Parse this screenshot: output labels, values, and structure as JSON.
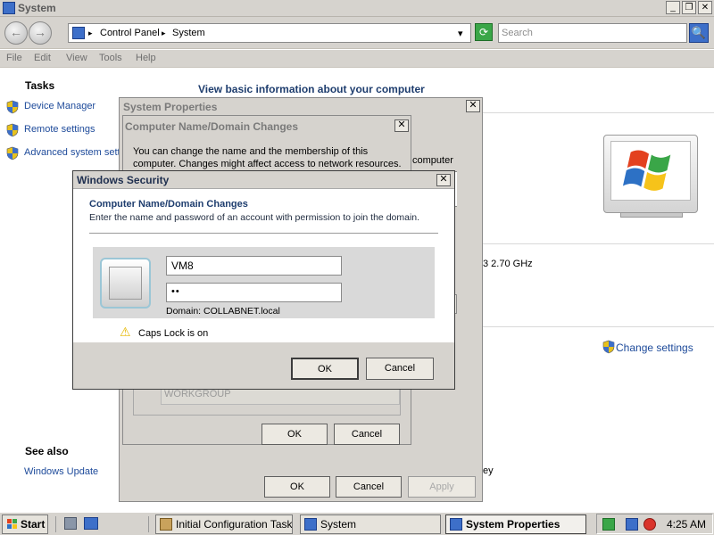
{
  "window": {
    "title": "System",
    "caption_buttons": {
      "min": "_",
      "max": "❐",
      "close": "✕"
    }
  },
  "nav": {
    "back": "←",
    "forward": "→",
    "breadcrumb": [
      "Control Panel",
      "System"
    ],
    "arrow": "▸",
    "dropdown": "▾",
    "refresh": "⟳",
    "search_placeholder": "Search",
    "search_icon": "🔍"
  },
  "menu": [
    "File",
    "Edit",
    "View",
    "Tools",
    "Help"
  ],
  "tasks": {
    "heading": "Tasks",
    "items": [
      "Device Manager",
      "Remote settings",
      "Advanced system settings"
    ]
  },
  "main": {
    "heading": "View basic information about your computer",
    "computer_fragment": "computer",
    "processor_fragment": "3   2.70 GHz",
    "change_settings": "Change settings",
    "ey_fragment": "ey"
  },
  "see_also": {
    "heading": "See also",
    "items": [
      "Windows Update"
    ]
  },
  "system_properties": {
    "title": "System Properties",
    "ok": "OK",
    "cancel": "Cancel",
    "apply": "Apply"
  },
  "cndc": {
    "title": "Computer Name/Domain Changes",
    "description": "You can change the name and the membership of this computer. Changes might affect access to network resources.",
    "workgroup_value": "WORKGROUP",
    "ok": "OK",
    "cancel": "Cancel"
  },
  "windows_security": {
    "title": "Windows Security",
    "heading": "Computer Name/Domain Changes",
    "subtitle": "Enter the name and password of an account with permission to join the domain.",
    "username": "VM8",
    "password": "••",
    "domain_label": "Domain: COLLABNET.local",
    "caps_warning": "Caps Lock is on",
    "warning_icon": "⚠",
    "ok": "OK",
    "cancel": "Cancel"
  },
  "taskbar": {
    "start": "Start",
    "items": [
      "Initial Configuration Tasks",
      "System",
      "System Properties"
    ],
    "clock": "4:25 AM"
  },
  "colors": {
    "link": "#1d4a9a",
    "title_gray": "#7a7a7a",
    "caps_warning": "#e6b800"
  }
}
